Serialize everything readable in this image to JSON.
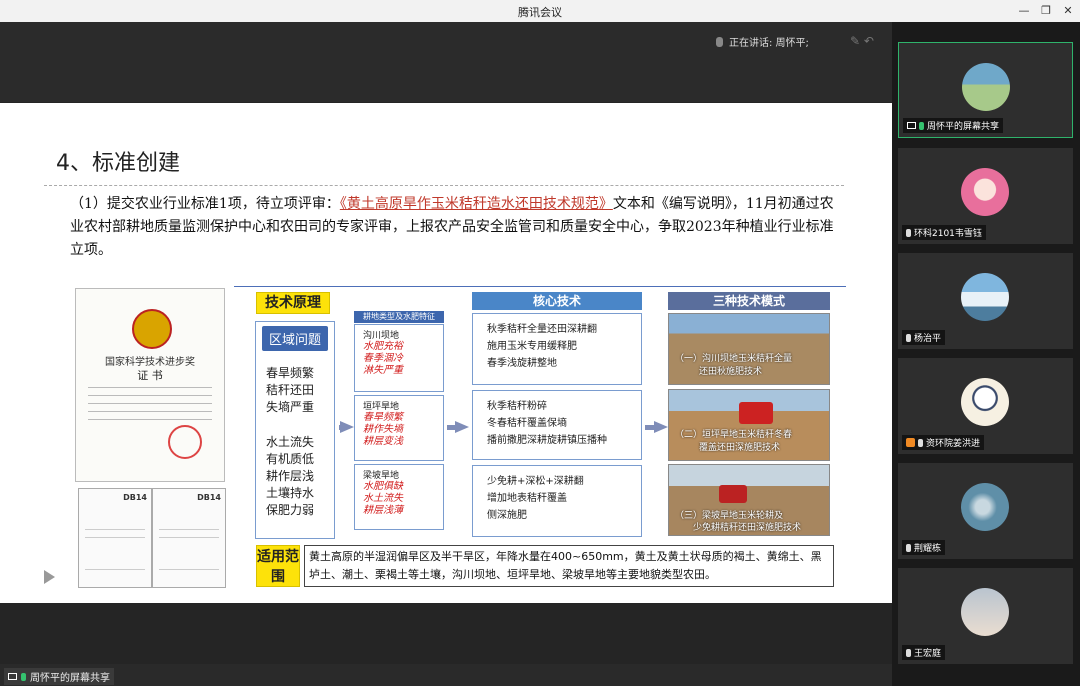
{
  "window": {
    "title": "腾讯会议",
    "min": "—",
    "restore": "❐",
    "close": "✕"
  },
  "speaking": {
    "label": "正在讲话: 周怀平;"
  },
  "share_label": "周怀平的屏幕共享",
  "slide": {
    "title": "4、标准创建",
    "para_prefix": "（1）提交农业行业标准1项，待立项评审：",
    "para_highlight": "《黄土高原旱作玉米秸秆造水还田技术规范》",
    "para_suffix": "文本和《编写说明》，11月初通过农业农村部耕地质量监测保护中心和农田司的专家评审，上报农产品安全监管司和质量安全中心，争取2023年种植业行业标准立项。",
    "cert": {
      "t1": "国家科学技术进步奖",
      "t2": "证  书"
    },
    "docs": [
      "DB14",
      "DB14"
    ],
    "tech_label": "技术原理",
    "region_head": "区域问题",
    "region_items_a": [
      "春旱频繁",
      "秸秆还田",
      "失墒严重"
    ],
    "region_items_b": [
      "水土流失",
      "有机质低",
      "耕作层浅",
      "土壤持水",
      "保肥力弱"
    ],
    "col2_head": "耕地类型及水肥特征",
    "col2": [
      {
        "name": "沟川坝地",
        "red": [
          "水肥充裕",
          "春季涸冷",
          "淋失严重"
        ]
      },
      {
        "name": "垣坪旱地",
        "red": [
          "春旱频繁",
          "耕作失墒",
          "耕层变浅"
        ]
      },
      {
        "name": "梁坡旱地",
        "red": [
          "水肥俱缺",
          "水土流失",
          "耕层浅薄"
        ]
      }
    ],
    "col3_head": "核心技术",
    "col3": [
      [
        "秋季秸秆全量还田深耕翻",
        "施用玉米专用缓释肥",
        "春季浅旋耕整地"
      ],
      [
        "秋季秸秆粉碎",
        "冬春秸秆覆盖保墒",
        "播前撒肥深耕旋耕镇压播种"
      ],
      [
        "少免耕+深松+深耕翻",
        "增加地表秸秆覆盖",
        "侧深施肥"
      ]
    ],
    "col4_head": "三种技术模式",
    "col4": [
      {
        "cap1": "（一）沟川坝地玉米秸秆全量",
        "cap2": "还田秋施肥技术"
      },
      {
        "cap1": "（二）垣坪旱地玉米秸秆冬春",
        "cap2": "覆盖还田深施肥技术"
      },
      {
        "cap1": "（三）梁坡旱地玉米轮耕及",
        "cap2": "少免耕秸秆还田深施肥技术"
      }
    ],
    "scope_label": "适用范围",
    "scope_text": "黄土高原的半湿润偏旱区及半干旱区，年降水量在400~650mm，黄土及黄土状母质的褐土、黄绵土、黑垆土、潮土、栗褐土等土壤，沟川坝地、垣坪旱地、梁坡旱地等主要地貌类型农田。"
  },
  "participants": [
    {
      "name": "周怀平的屏幕共享",
      "colors": [
        "#6fa8c9",
        "#a7c98a"
      ]
    },
    {
      "name": "环科2101韦雪钰",
      "colors": [
        "#f3a9c5",
        "#e86f9c"
      ]
    },
    {
      "name": "杨治平",
      "colors": [
        "#7fb6de",
        "#e8f1f7"
      ]
    },
    {
      "name": "资环院姜洪进",
      "colors": [
        "#f6f0e2",
        "#3a4a6b"
      ]
    },
    {
      "name": "荆耀栋",
      "colors": [
        "#5f8fa8",
        "#c8d8e0"
      ]
    },
    {
      "name": "王宏庭",
      "colors": [
        "#b9c4cf",
        "#e9ddd0"
      ]
    }
  ],
  "colors": {
    "accent": "#2fb36b",
    "highlight": "#c0392b",
    "table_blue": "#4a86c8"
  }
}
